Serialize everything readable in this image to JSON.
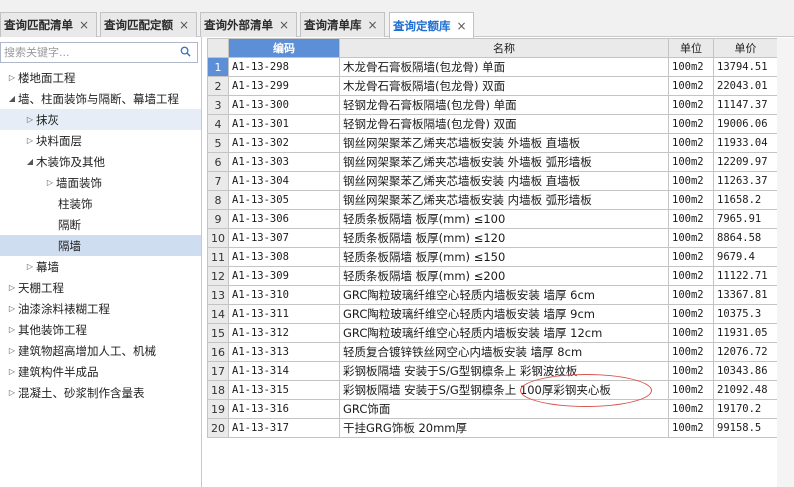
{
  "tabs": [
    {
      "label": "查询匹配清单",
      "close": "×"
    },
    {
      "label": "查询匹配定额",
      "close": "×"
    },
    {
      "label": "查询外部清单",
      "close": "×"
    },
    {
      "label": "查询清单库",
      "close": "×"
    },
    {
      "label": "查询定额库",
      "close": "×"
    }
  ],
  "search": {
    "placeholder": "搜索关键字..."
  },
  "tree": [
    {
      "label": "楼地面工程",
      "arrow": "▷"
    },
    {
      "label": "墙、柱面装饰与隔断、幕墙工程",
      "arrow": "◢"
    },
    {
      "label": "抹灰",
      "arrow": "▷"
    },
    {
      "label": "块料面层",
      "arrow": "▷"
    },
    {
      "label": "木装饰及其他",
      "arrow": "◢"
    },
    {
      "label": "墙面装饰",
      "arrow": "▷"
    },
    {
      "label": "柱装饰",
      "arrow": ""
    },
    {
      "label": "隔断",
      "arrow": ""
    },
    {
      "label": "隔墙",
      "arrow": ""
    },
    {
      "label": "幕墙",
      "arrow": "▷"
    },
    {
      "label": "天棚工程",
      "arrow": "▷"
    },
    {
      "label": "油漆涂料裱糊工程",
      "arrow": "▷"
    },
    {
      "label": "其他装饰工程",
      "arrow": "▷"
    },
    {
      "label": "建筑物超高增加人工、机械",
      "arrow": "▷"
    },
    {
      "label": "建筑构件半成品",
      "arrow": "▷"
    },
    {
      "label": "混凝土、砂浆制作含量表",
      "arrow": "▷"
    }
  ],
  "table": {
    "headers": [
      "编码",
      "名称",
      "单位",
      "单价"
    ],
    "rows": [
      {
        "n": "1",
        "code": "A1-13-298",
        "name": "木龙骨石膏板隔墙(包龙骨) 单面",
        "unit": "100m2",
        "price": "13794.51"
      },
      {
        "n": "2",
        "code": "A1-13-299",
        "name": "木龙骨石膏板隔墙(包龙骨) 双面",
        "unit": "100m2",
        "price": "22043.01"
      },
      {
        "n": "3",
        "code": "A1-13-300",
        "name": "轻钢龙骨石膏板隔墙(包龙骨) 单面",
        "unit": "100m2",
        "price": "11147.37"
      },
      {
        "n": "4",
        "code": "A1-13-301",
        "name": "轻钢龙骨石膏板隔墙(包龙骨) 双面",
        "unit": "100m2",
        "price": "19006.06"
      },
      {
        "n": "5",
        "code": "A1-13-302",
        "name": "钢丝网架聚苯乙烯夹芯墙板安装 外墙板 直墙板",
        "unit": "100m2",
        "price": "11933.04"
      },
      {
        "n": "6",
        "code": "A1-13-303",
        "name": "钢丝网架聚苯乙烯夹芯墙板安装 外墙板 弧形墙板",
        "unit": "100m2",
        "price": "12209.97"
      },
      {
        "n": "7",
        "code": "A1-13-304",
        "name": "钢丝网架聚苯乙烯夹芯墙板安装 内墙板 直墙板",
        "unit": "100m2",
        "price": "11263.37"
      },
      {
        "n": "8",
        "code": "A1-13-305",
        "name": "钢丝网架聚苯乙烯夹芯墙板安装 内墙板 弧形墙板",
        "unit": "100m2",
        "price": "11658.2"
      },
      {
        "n": "9",
        "code": "A1-13-306",
        "name": "轻质条板隔墙 板厚(mm) ≤100",
        "unit": "100m2",
        "price": "7965.91"
      },
      {
        "n": "10",
        "code": "A1-13-307",
        "name": "轻质条板隔墙 板厚(mm) ≤120",
        "unit": "100m2",
        "price": "8864.58"
      },
      {
        "n": "11",
        "code": "A1-13-308",
        "name": "轻质条板隔墙 板厚(mm) ≤150",
        "unit": "100m2",
        "price": "9679.4"
      },
      {
        "n": "12",
        "code": "A1-13-309",
        "name": "轻质条板隔墙 板厚(mm) ≤200",
        "unit": "100m2",
        "price": "11122.71"
      },
      {
        "n": "13",
        "code": "A1-13-310",
        "name": "GRC陶粒玻璃纤维空心轻质内墙板安装 墙厚 6cm",
        "unit": "100m2",
        "price": "13367.81"
      },
      {
        "n": "14",
        "code": "A1-13-311",
        "name": "GRC陶粒玻璃纤维空心轻质内墙板安装 墙厚 9cm",
        "unit": "100m2",
        "price": "10375.3"
      },
      {
        "n": "15",
        "code": "A1-13-312",
        "name": "GRC陶粒玻璃纤维空心轻质内墙板安装 墙厚 12cm",
        "unit": "100m2",
        "price": "11931.05"
      },
      {
        "n": "16",
        "code": "A1-13-313",
        "name": "轻质复合镀锌铁丝网空心内墙板安装 墙厚 8cm",
        "unit": "100m2",
        "price": "12076.72"
      },
      {
        "n": "17",
        "code": "A1-13-314",
        "name": "彩钢板隔墙 安装于S/G型钢檩条上 彩钢波纹板",
        "unit": "100m2",
        "price": "10343.86"
      },
      {
        "n": "18",
        "code": "A1-13-315",
        "name": "彩钢板隔墙 安装于S/G型钢檩条上 100厚彩钢夹心板",
        "unit": "100m2",
        "price": "21092.48"
      },
      {
        "n": "19",
        "code": "A1-13-316",
        "name": "GRC饰面",
        "unit": "100m2",
        "price": "19170.2"
      },
      {
        "n": "20",
        "code": "A1-13-317",
        "name": "干挂GRG饰板 20mm厚",
        "unit": "100m2",
        "price": "99158.5"
      }
    ]
  },
  "colors": {
    "accent": "#1f6fd1",
    "selected_header": "#5c8fd6",
    "tree_selected": "#cfddf0",
    "annotation": "#d9534f"
  }
}
